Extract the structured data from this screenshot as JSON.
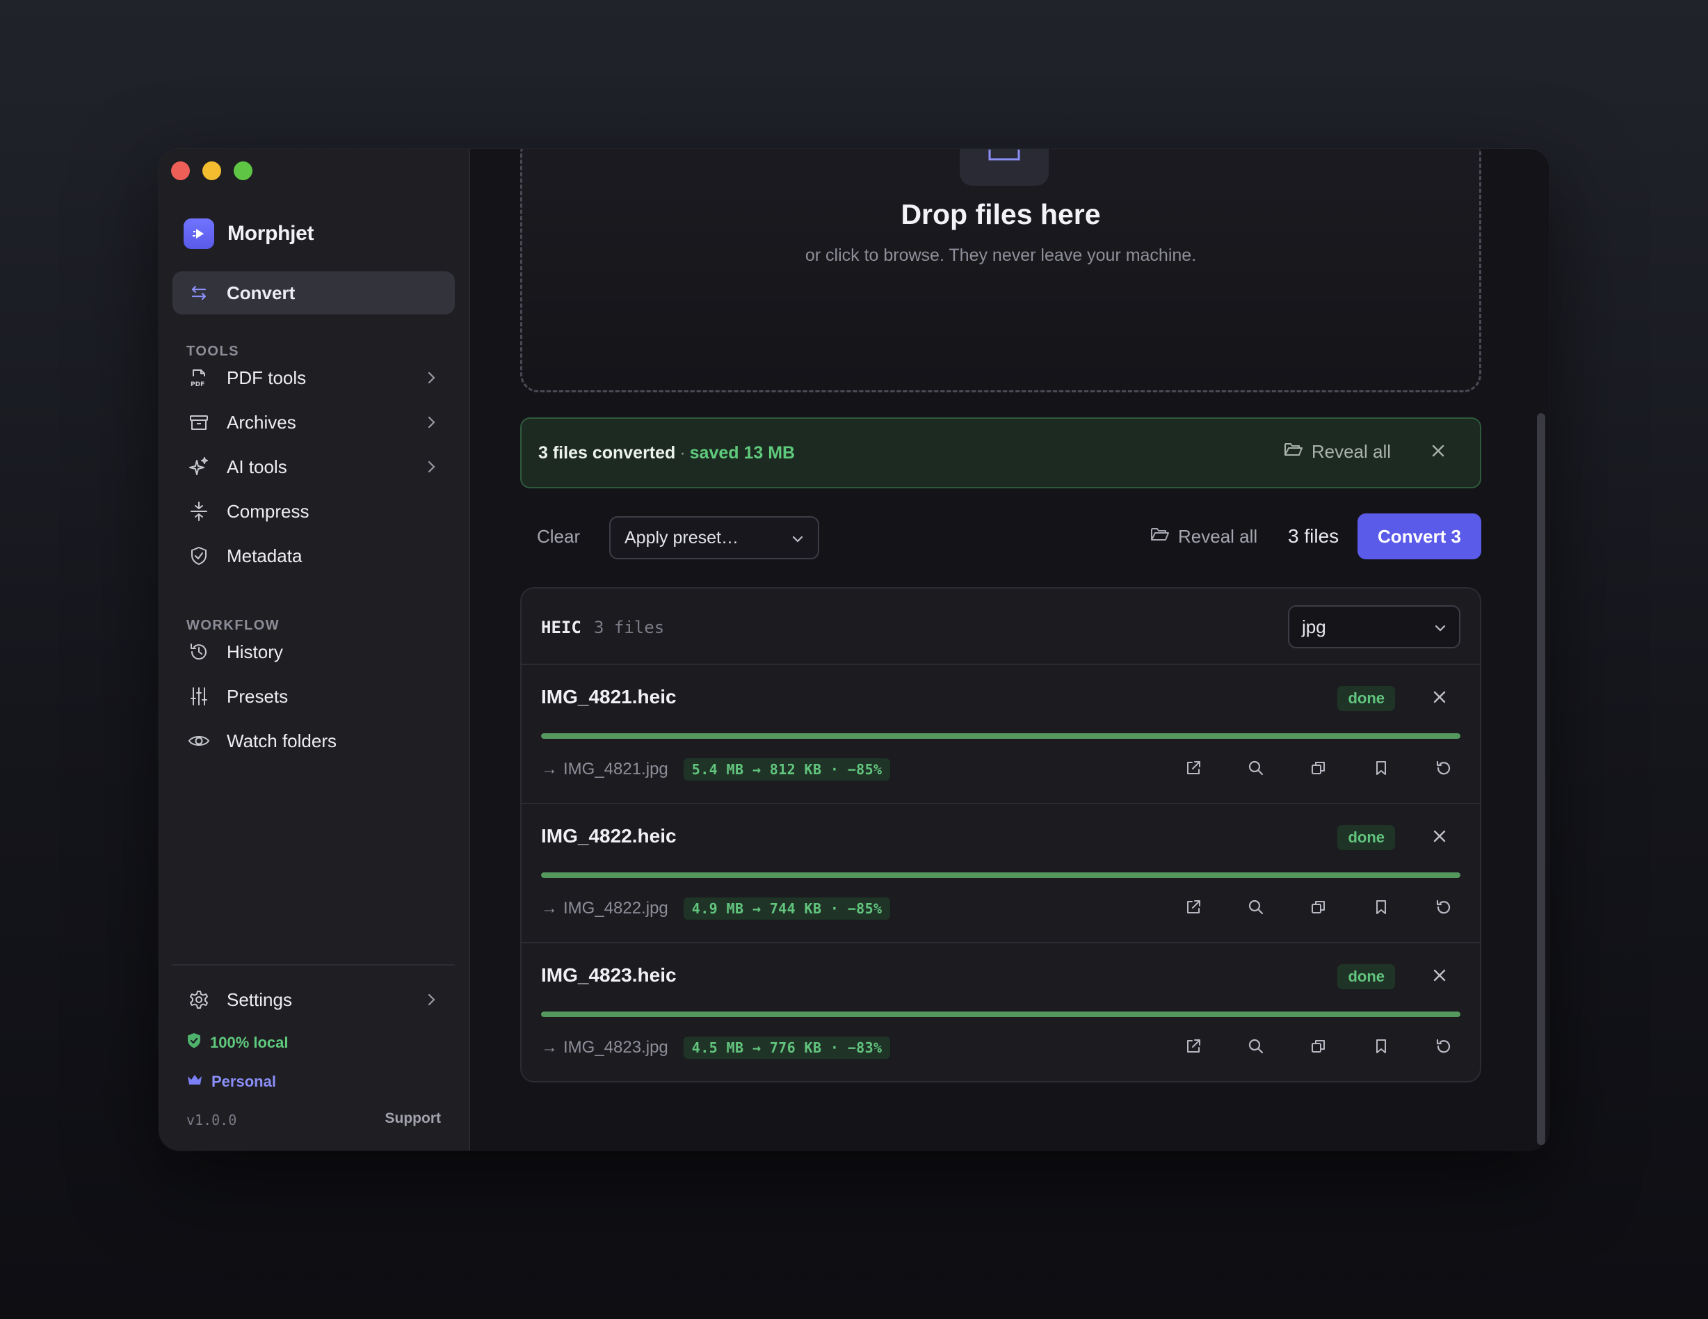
{
  "app": {
    "name": "Morphjet"
  },
  "sidebar": {
    "active_item": {
      "label": "Convert",
      "icon": "convert-arrows-icon"
    },
    "tools_title": "TOOLS",
    "tools": [
      {
        "label": "PDF tools",
        "icon": "pdf-icon",
        "has_chevron": true
      },
      {
        "label": "Archives",
        "icon": "archive-icon",
        "has_chevron": true
      },
      {
        "label": "AI tools",
        "icon": "sparkle-icon",
        "has_chevron": true
      },
      {
        "label": "Compress",
        "icon": "compress-icon",
        "has_chevron": false
      },
      {
        "label": "Metadata",
        "icon": "shield-check-icon",
        "has_chevron": false
      }
    ],
    "workflow_title": "WORKFLOW",
    "workflow": [
      {
        "label": "History",
        "icon": "history-icon"
      },
      {
        "label": "Presets",
        "icon": "sliders-icon"
      },
      {
        "label": "Watch folders",
        "icon": "eye-icon"
      }
    ],
    "settings_label": "Settings",
    "local_label": "100% local",
    "plan_label": "Personal",
    "version": "v1.0.0",
    "support_label": "Support"
  },
  "dropzone": {
    "title": "Drop files here",
    "subtitle": "or click to browse. They never leave your machine."
  },
  "banner": {
    "text": "3 files converted",
    "separator": "·",
    "saved": "saved 13 MB",
    "reveal_label": "Reveal all"
  },
  "toolbar": {
    "clear_label": "Clear",
    "preset_label": "Apply preset…",
    "reveal_label": "Reveal all",
    "count_label": "3 files",
    "convert_label": "Convert 3"
  },
  "group": {
    "format": "HEIC",
    "count": "3 files",
    "target_format": "jpg"
  },
  "files": [
    {
      "name": "IMG_4821.heic",
      "status": "done",
      "progress": 1.0,
      "output": "IMG_4821.jpg",
      "size_change": "5.4 MB → 812 KB · −85%"
    },
    {
      "name": "IMG_4822.heic",
      "status": "done",
      "progress": 1.0,
      "output": "IMG_4822.jpg",
      "size_change": "4.9 MB → 744 KB · −85%"
    },
    {
      "name": "IMG_4823.heic",
      "status": "done",
      "progress": 1.0,
      "output": "IMG_4823.jpg",
      "size_change": "4.5 MB → 776 KB · −83%"
    }
  ],
  "colors": {
    "accent": "#5b5bea",
    "success": "#5fca7c",
    "plan": "#8b8ff8"
  }
}
